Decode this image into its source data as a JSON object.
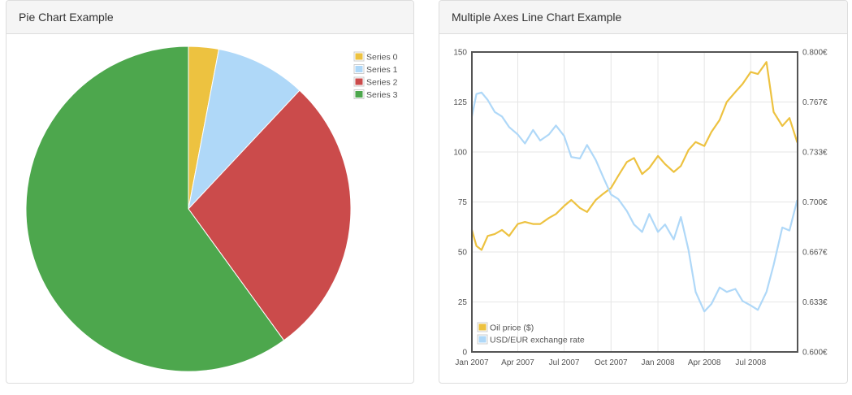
{
  "colors": {
    "yellow": "#edc240",
    "light_blue": "#afd8f8",
    "red": "#cb4b4b",
    "green": "#4da74d"
  },
  "panels": {
    "pie": {
      "title": "Pie Chart Example"
    },
    "line": {
      "title": "Multiple Axes Line Chart Example"
    }
  },
  "chart_data": [
    {
      "type": "pie",
      "title": "Pie Chart Example",
      "legend_position": "top-right",
      "series": [
        {
          "name": "Series 0",
          "value": 3,
          "color": "#edc240"
        },
        {
          "name": "Series 1",
          "value": 9,
          "color": "#afd8f8"
        },
        {
          "name": "Series 2",
          "value": 28,
          "color": "#cb4b4b"
        },
        {
          "name": "Series 3",
          "value": 60,
          "color": "#4da74d"
        }
      ]
    },
    {
      "type": "line",
      "title": "Multiple Axes Line Chart Example",
      "legend_position": "bottom-left",
      "grid": true,
      "x_ticks": [
        "Jan 2007",
        "Apr 2007",
        "Jul 2007",
        "Oct 2007",
        "Jan 2008",
        "Apr 2008",
        "Jul 2008"
      ],
      "y_left": {
        "ylim": [
          0,
          150
        ],
        "ticks": [
          "0",
          "25",
          "50",
          "75",
          "100",
          "125",
          "150"
        ]
      },
      "y_right": {
        "ylim": [
          0.6,
          0.8
        ],
        "ticks": [
          "0.600€",
          "0.633€",
          "0.667€",
          "0.700€",
          "0.733€",
          "0.767€",
          "0.800€"
        ]
      },
      "series": [
        {
          "name": "Oil price ($)",
          "axis": "left",
          "color": "#edc240",
          "x": [
            "2007-01-01",
            "2007-01-10",
            "2007-01-20",
            "2007-02-01",
            "2007-02-15",
            "2007-03-01",
            "2007-03-15",
            "2007-04-01",
            "2007-04-15",
            "2007-05-01",
            "2007-05-15",
            "2007-06-01",
            "2007-06-15",
            "2007-07-01",
            "2007-07-15",
            "2007-08-01",
            "2007-08-15",
            "2007-09-01",
            "2007-09-15",
            "2007-10-01",
            "2007-10-15",
            "2007-11-01",
            "2007-11-15",
            "2007-12-01",
            "2007-12-15",
            "2008-01-01",
            "2008-01-15",
            "2008-02-01",
            "2008-02-15",
            "2008-03-01",
            "2008-03-15",
            "2008-04-01",
            "2008-04-15",
            "2008-05-01",
            "2008-05-15",
            "2008-06-01",
            "2008-06-15",
            "2008-07-01",
            "2008-07-15",
            "2008-08-01",
            "2008-08-15",
            "2008-09-01",
            "2008-09-15",
            "2008-09-30"
          ],
          "values": [
            61,
            53,
            51,
            58,
            59,
            61,
            58,
            64,
            65,
            64,
            64,
            67,
            69,
            73,
            76,
            72,
            70,
            76,
            79,
            82,
            88,
            95,
            97,
            89,
            92,
            98,
            94,
            90,
            93,
            101,
            105,
            103,
            110,
            116,
            125,
            130,
            134,
            140,
            139,
            145,
            120,
            113,
            117,
            105
          ]
        },
        {
          "name": "USD/EUR exchange rate",
          "axis": "right",
          "color": "#afd8f8",
          "x": [
            "2007-01-01",
            "2007-01-10",
            "2007-01-20",
            "2007-02-01",
            "2007-02-15",
            "2007-03-01",
            "2007-03-15",
            "2007-04-01",
            "2007-04-15",
            "2007-05-01",
            "2007-05-15",
            "2007-06-01",
            "2007-06-15",
            "2007-07-01",
            "2007-07-15",
            "2007-08-01",
            "2007-08-15",
            "2007-09-01",
            "2007-09-15",
            "2007-10-01",
            "2007-10-15",
            "2007-11-01",
            "2007-11-15",
            "2007-12-01",
            "2007-12-15",
            "2008-01-01",
            "2008-01-15",
            "2008-02-01",
            "2008-02-15",
            "2008-03-01",
            "2008-03-15",
            "2008-04-01",
            "2008-04-15",
            "2008-05-01",
            "2008-05-15",
            "2008-06-01",
            "2008-06-15",
            "2008-07-01",
            "2008-07-15",
            "2008-08-01",
            "2008-08-15",
            "2008-09-01",
            "2008-09-15",
            "2008-09-30"
          ],
          "values": [
            0.757,
            0.772,
            0.773,
            0.768,
            0.76,
            0.757,
            0.75,
            0.745,
            0.739,
            0.748,
            0.741,
            0.745,
            0.751,
            0.744,
            0.73,
            0.729,
            0.738,
            0.728,
            0.717,
            0.705,
            0.702,
            0.694,
            0.685,
            0.68,
            0.692,
            0.68,
            0.685,
            0.675,
            0.69,
            0.668,
            0.64,
            0.627,
            0.632,
            0.643,
            0.64,
            0.642,
            0.634,
            0.631,
            0.628,
            0.64,
            0.658,
            0.683,
            0.681,
            0.701
          ]
        }
      ]
    }
  ]
}
